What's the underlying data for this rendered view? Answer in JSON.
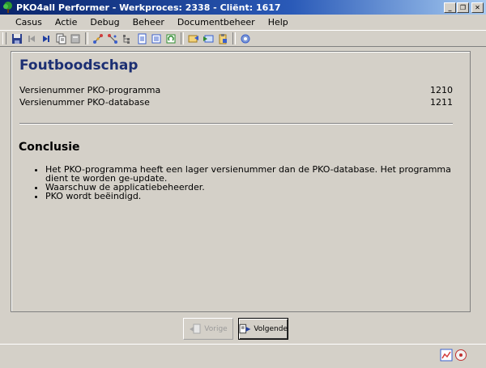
{
  "window": {
    "title": "PKO4all Performer - Werkproces: 2338 - Cliënt: 1617",
    "minimize_glyph": "_",
    "restore_glyph": "❐",
    "close_glyph": "✕"
  },
  "menu": {
    "items": [
      {
        "label": "Casus"
      },
      {
        "label": "Actie"
      },
      {
        "label": "Debug"
      },
      {
        "label": "Beheer"
      },
      {
        "label": "Documentbeheer"
      },
      {
        "label": "Help"
      }
    ]
  },
  "toolbar": {
    "icons": [
      "save-icon",
      "first-icon",
      "last-icon",
      "copy-icon",
      "calculator-icon",
      "branch-icon",
      "merge-icon",
      "tree-icon",
      "document-icon",
      "list-icon",
      "refresh-icon",
      "export-icon",
      "import-icon",
      "clipboard-icon",
      "settings-icon"
    ]
  },
  "main": {
    "title": "Foutboodschap",
    "versions": [
      {
        "label": "Versienummer PKO-programma",
        "value": "1210"
      },
      {
        "label": "Versienummer PKO-database",
        "value": "1211"
      }
    ],
    "conclusion_title": "Conclusie",
    "conclusion_items": [
      "Het PKO-programma heeft een lager versienummer dan de PKO-database. Het programma dient te worden ge-update.",
      "Waarschuw de applicatiebeheerder.",
      "PKO wordt beëindigd."
    ]
  },
  "nav": {
    "prev_label": "Vorige",
    "next_label": "Volgende"
  },
  "colors": {
    "title_blue": "#1c2f73",
    "titlebar_start": "#0a246a",
    "titlebar_end": "#a6caf0",
    "background": "#d4d0c8"
  }
}
